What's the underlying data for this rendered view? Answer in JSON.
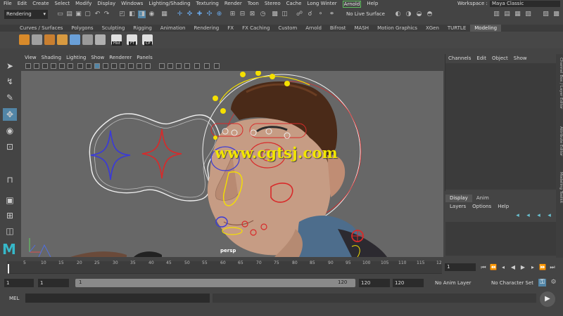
{
  "menubar": {
    "items": [
      "File",
      "Edit",
      "Create",
      "Select",
      "Modify",
      "Display",
      "Windows",
      "Lighting/Shading",
      "Texturing",
      "Render",
      "Toon",
      "Stereo",
      "Cache",
      "Long Winter",
      "Arnold",
      "Help"
    ],
    "workspace_label": "Workspace :",
    "workspace_value": "Maya Classic"
  },
  "statusline": {
    "mode": "Rendering",
    "live_surface": "No Live Surface"
  },
  "shelf": {
    "tabs": [
      "Curves / Surfaces",
      "Polygons",
      "Sculpting",
      "Rigging",
      "Animation",
      "Rendering",
      "FX",
      "FX Caching",
      "Custom",
      "Arnold",
      "Bifrost",
      "MASH",
      "Motion Graphics",
      "XGen",
      "TURTLE",
      "Modeling"
    ],
    "active_tab": "Modeling",
    "button_labels": [
      "Hist",
      "FT",
      "CP"
    ]
  },
  "viewport": {
    "menu": [
      "View",
      "Shading",
      "Lighting",
      "Show",
      "Renderer",
      "Panels"
    ],
    "camera_label": "persp",
    "watermark": "www.cgtsj.com"
  },
  "channel_box": {
    "menu": [
      "Channels",
      "Edit",
      "Object",
      "Show"
    ]
  },
  "side_tabs": [
    "Channel Box / Layer Editor",
    "Attribute Editor",
    "Modeling Toolkit"
  ],
  "layer_editor": {
    "tabs": [
      "Display",
      "Anim"
    ],
    "active_tab": "Display",
    "menu": [
      "Layers",
      "Options",
      "Help"
    ]
  },
  "timeslider": {
    "ticks": [
      "5",
      "10",
      "15",
      "20",
      "25",
      "30",
      "35",
      "40",
      "45",
      "50",
      "55",
      "60",
      "65",
      "70",
      "75",
      "80",
      "85",
      "90",
      "95",
      "100",
      "105",
      "110",
      "115",
      "12"
    ],
    "current_frame": "1"
  },
  "range": {
    "start_field": "1",
    "playback_start": "1",
    "range_start_label": "1",
    "range_end_label": "120",
    "playback_end": "120",
    "end_field": "120",
    "anim_layer": "No Anim Layer",
    "character_set": "No Character Set"
  },
  "cmdline": {
    "label": "MEL"
  },
  "colors": {
    "viewport_bg": "#676767",
    "accent_blue": "#5285a6",
    "control_yellow": "#f5e000",
    "control_red": "#d82a2a",
    "control_blue": "#3a3ad8",
    "maya_teal": "#36b8c9"
  }
}
